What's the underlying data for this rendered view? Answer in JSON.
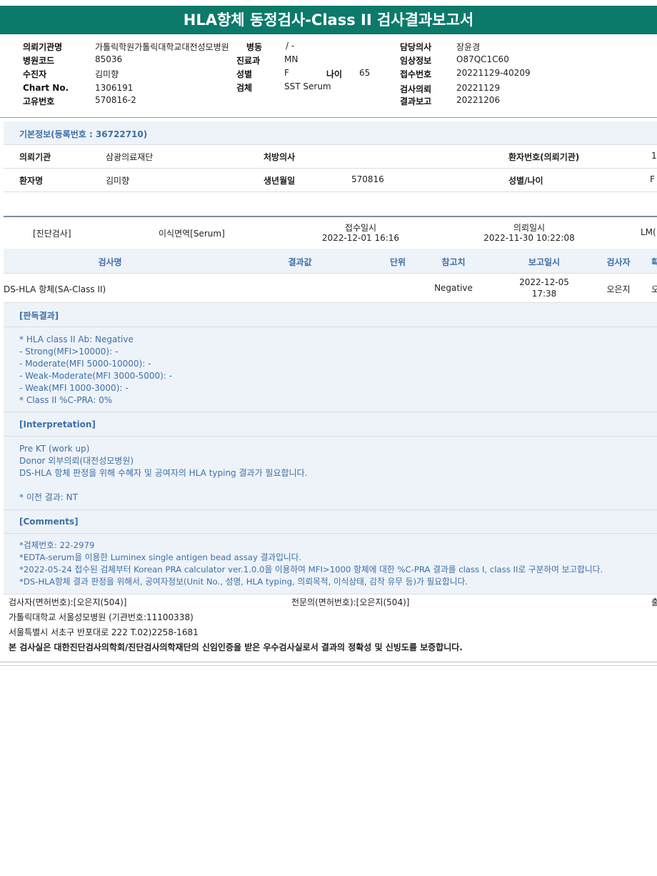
{
  "title": "HLA항체 동정검사-Class II 검사결과보고서",
  "header": {
    "req_org_label": "의뢰기관명",
    "req_org_value": "가톨릭학원가톨릭대학교대전성모병원",
    "hosp_code_label": "병원코드",
    "hosp_code_value": "85036",
    "patient_label": "수진자",
    "patient_value": "김미향",
    "chart_label": "Chart No.",
    "chart_value": "1306191",
    "unique_label": "고유번호",
    "unique_value": "570816-2",
    "ward_label": "병동",
    "ward_value": "/ -",
    "dept_label": "진료과",
    "dept_value": "MN",
    "sex_label": "성별",
    "sex_value": "F",
    "age_label": "나이",
    "age_value": "65",
    "specimen_label": "검체",
    "specimen_value": "SST Serum",
    "doctor_label": "담당의사",
    "doctor_value": "장윤경",
    "clinical_label": "임상정보",
    "clinical_value": "O87QC1C60",
    "receipt_label": "접수번호",
    "receipt_value": "20221129-40209",
    "test_req_label": "검사의뢰",
    "test_req_value": "20221129",
    "result_label": "결과보고",
    "result_value": "20221206"
  },
  "basic": {
    "section_title": "기본정보(등록번호 : 36722710)",
    "req_inst_label": "의뢰기관",
    "req_inst_value": "삼광의료재단",
    "presc_label": "처방의사",
    "presc_value": "",
    "patno_label": "환자번호(의뢰기관)",
    "patno_value": "1",
    "name_label": "환자명",
    "name_value": "김미향",
    "dob_label": "생년월일",
    "dob_value": "570816",
    "sexage_label": "성별/나이",
    "sexage_value": "F"
  },
  "exam": {
    "category": "[진단검사]",
    "type": "이식면역[Serum]",
    "recv_label": "접수일시",
    "recv_value": "2022-12-01  16:16",
    "req_label": "의뢰일시",
    "req_value": "2022-11-30  10:22:08",
    "right_cut": "LM("
  },
  "table": {
    "headers": [
      "검사명",
      "결과값",
      "단위",
      "참고치",
      "보고일시",
      "검사자",
      "확"
    ],
    "row": {
      "name": "DS-HLA 항체(SA-Class II)",
      "result": "",
      "unit": "",
      "ref": "Negative",
      "report_date": "2022-12-05",
      "report_time": "17:38",
      "tester": "오은지",
      "confirm": "오"
    }
  },
  "interp": {
    "title": "[판독결과]",
    "lines": [
      "* HLA class II Ab: Negative",
      "- Strong(MFI>10000): -",
      "- Moderate(MFI 5000-10000): -",
      "- Weak-Moderate(MFI 3000-5000): -",
      "- Weak(MFI 1000-3000): -",
      "* Class II %C-PRA: 0%"
    ]
  },
  "interpretation": {
    "title": "[Interpretation]",
    "lines": [
      "Pre KT (work up)",
      "Donor 외부의뢰(대전성모병원)",
      "DS-HLA 항체 판정을 위해 수혜자 및 공여자의 HLA typing 결과가 필요합니다.",
      "",
      "* 이전 결과: NT"
    ]
  },
  "comments": {
    "title": "[Comments]",
    "lines": [
      "*검체번호: 22-2979",
      "*EDTA-serum을 이용한 Luminex single antigen bead assay 결과입니다.",
      "*2022-05-24 접수된 검체부터 Korean PRA calculator ver.1.0.0을 이용하여 MFI>1000 항체에 대한 %C-PRA 결과를 class I, class II로 구분하여 보고합니다.",
      "*DS-HLA항체 결과 판정을 위해서, 공여자정보(Unit No., 성명, HLA typing, 의뢰목적, 이식상태, 감작 유무 등)가 필요합니다."
    ]
  },
  "footer": {
    "tester": "검사자(면허번호):[오은지(504)]",
    "specialist": "전문의(면허번호):[오은지(504)]",
    "right_cut": "출",
    "hospital": "가톨릭대학교 서울성모병원 (기관번호:11100338)",
    "address": "서울특별시 서초구 반포대로 222 T.02)2258-1681",
    "cert": "본 검사실은 대한진단검사의학회/진단검사의학재단의 신임인증을 받은 우수검사실로서 결과의 정확성 및 신빙도를 보증합니다."
  },
  "colors": {
    "title_bar": "#0b7a6a",
    "accent_text": "#3c6fa8",
    "band": "#eef3f9"
  }
}
